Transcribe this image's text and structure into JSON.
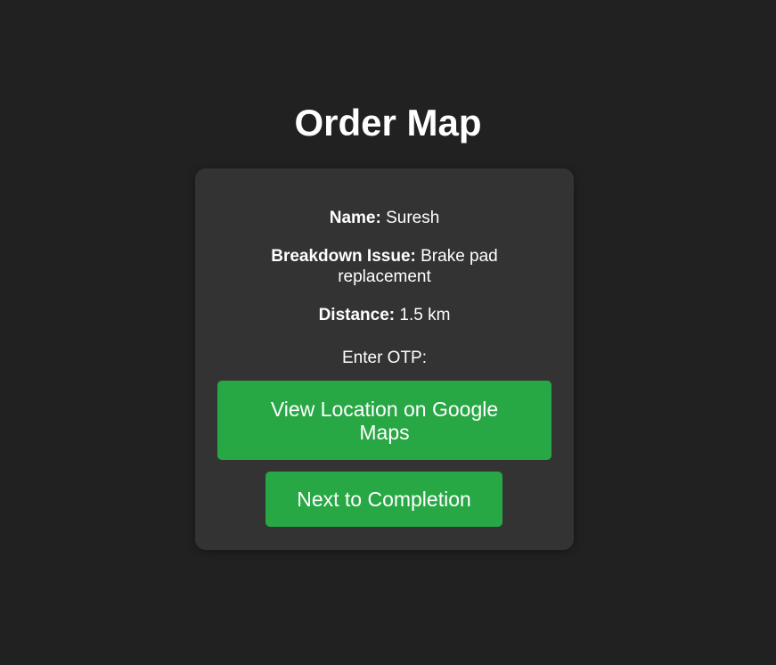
{
  "page": {
    "title": "Order Map"
  },
  "order": {
    "name_label": "Name:",
    "name_value": "Suresh",
    "issue_label": "Breakdown Issue:",
    "issue_value": "Brake pad replacement",
    "distance_label": "Distance:",
    "distance_value": "1.5 km",
    "otp_label": "Enter OTP:"
  },
  "actions": {
    "view_location_label": "View Location on Google Maps",
    "next_label": "Next to Completion"
  },
  "colors": {
    "background": "#212121",
    "card": "#333333",
    "button": "#28a745",
    "text": "#ffffff"
  }
}
